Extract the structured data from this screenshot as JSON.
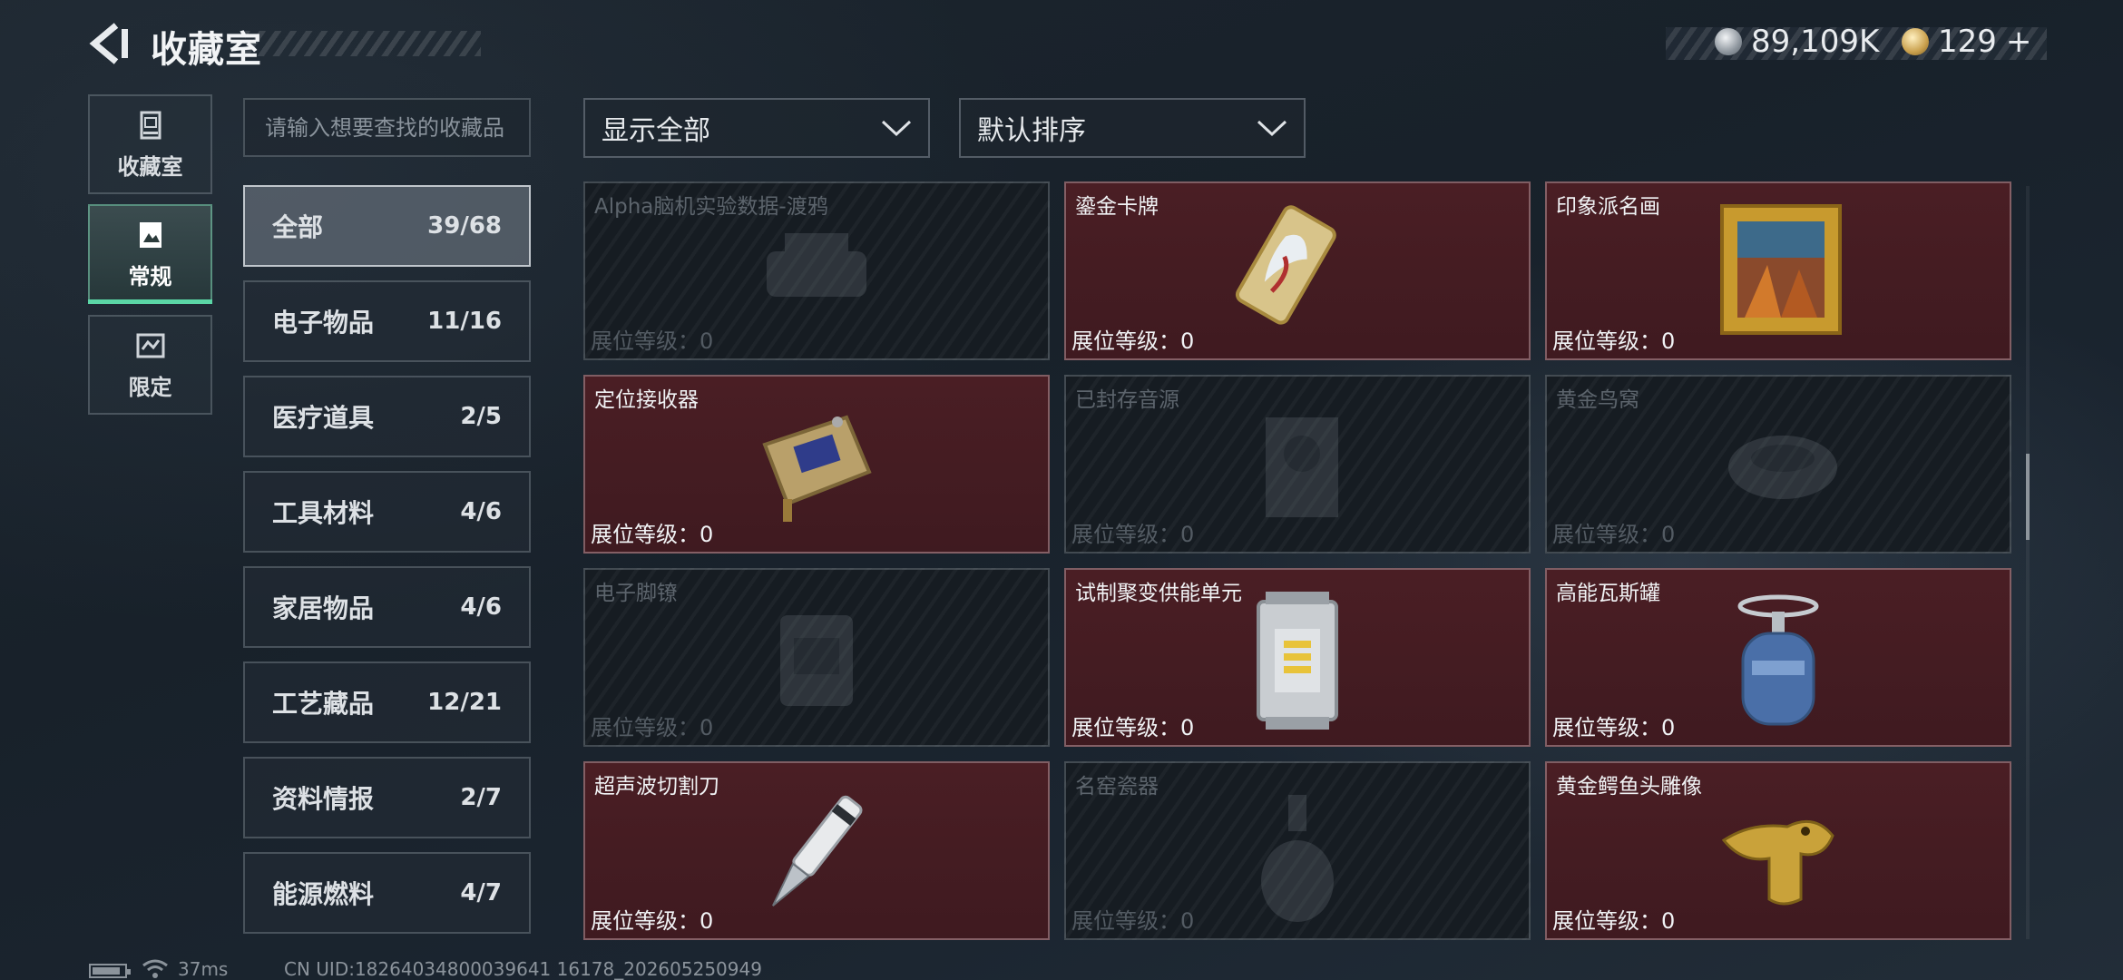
{
  "header": {
    "title": "收藏室",
    "currency_silver": "89,109K",
    "currency_gold": "129",
    "currency_gold_add": "+"
  },
  "side_tabs": [
    {
      "label": "收藏室",
      "icon": "collection-room-icon",
      "active": false
    },
    {
      "label": "常规",
      "icon": "regular-icon",
      "active": true
    },
    {
      "label": "限定",
      "icon": "limited-icon",
      "active": false
    }
  ],
  "search": {
    "placeholder": "请输入想要查找的收藏品",
    "value": ""
  },
  "categories": [
    {
      "name": "全部",
      "count": "39/68",
      "active": true
    },
    {
      "name": "电子物品",
      "count": "11/16",
      "active": false
    },
    {
      "name": "医疗道具",
      "count": "2/5",
      "active": false
    },
    {
      "name": "工具材料",
      "count": "4/6",
      "active": false
    },
    {
      "name": "家居物品",
      "count": "4/6",
      "active": false
    },
    {
      "name": "工艺藏品",
      "count": "12/21",
      "active": false
    },
    {
      "name": "资料情报",
      "count": "2/7",
      "active": false
    },
    {
      "name": "能源燃料",
      "count": "4/7",
      "active": false
    }
  ],
  "filters": {
    "display": "显示全部",
    "sort": "默认排序"
  },
  "items": [
    {
      "name": "Alpha脑机实验数据-渡鸦",
      "level": "展位等级：0",
      "owned": false,
      "icon": "data-chip-icon"
    },
    {
      "name": "鎏金卡牌",
      "level": "展位等级：0",
      "owned": true,
      "icon": "gilded-card-icon"
    },
    {
      "name": "印象派名画",
      "level": "展位等级：0",
      "owned": true,
      "icon": "painting-icon"
    },
    {
      "name": "定位接收器",
      "level": "展位等级：0",
      "owned": true,
      "icon": "gps-receiver-icon"
    },
    {
      "name": "已封存音源",
      "level": "展位等级：0",
      "owned": false,
      "icon": "audio-source-icon"
    },
    {
      "name": "黄金鸟窝",
      "level": "展位等级：0",
      "owned": false,
      "icon": "golden-nest-icon"
    },
    {
      "name": "电子脚镣",
      "level": "展位等级：0",
      "owned": false,
      "icon": "ankle-monitor-icon"
    },
    {
      "name": "试制聚变供能单元",
      "level": "展位等级：0",
      "owned": true,
      "icon": "fusion-cell-icon"
    },
    {
      "name": "高能瓦斯罐",
      "level": "展位等级：0",
      "owned": true,
      "icon": "gas-canister-icon"
    },
    {
      "name": "超声波切割刀",
      "level": "展位等级：0",
      "owned": true,
      "icon": "ultrasonic-cutter-icon"
    },
    {
      "name": "名窑瓷器",
      "level": "展位等级：0",
      "owned": false,
      "icon": "porcelain-vase-icon"
    },
    {
      "name": "黄金鳄鱼头雕像",
      "level": "展位等级：0",
      "owned": true,
      "icon": "golden-crocodile-icon"
    }
  ],
  "footer": {
    "ping": "37ms",
    "uid": "CN UID:18264034800039641 16178_202605250949"
  },
  "colors": {
    "owned_card": "#4a1e24",
    "active_tab_accent": "#5bd6a6"
  }
}
